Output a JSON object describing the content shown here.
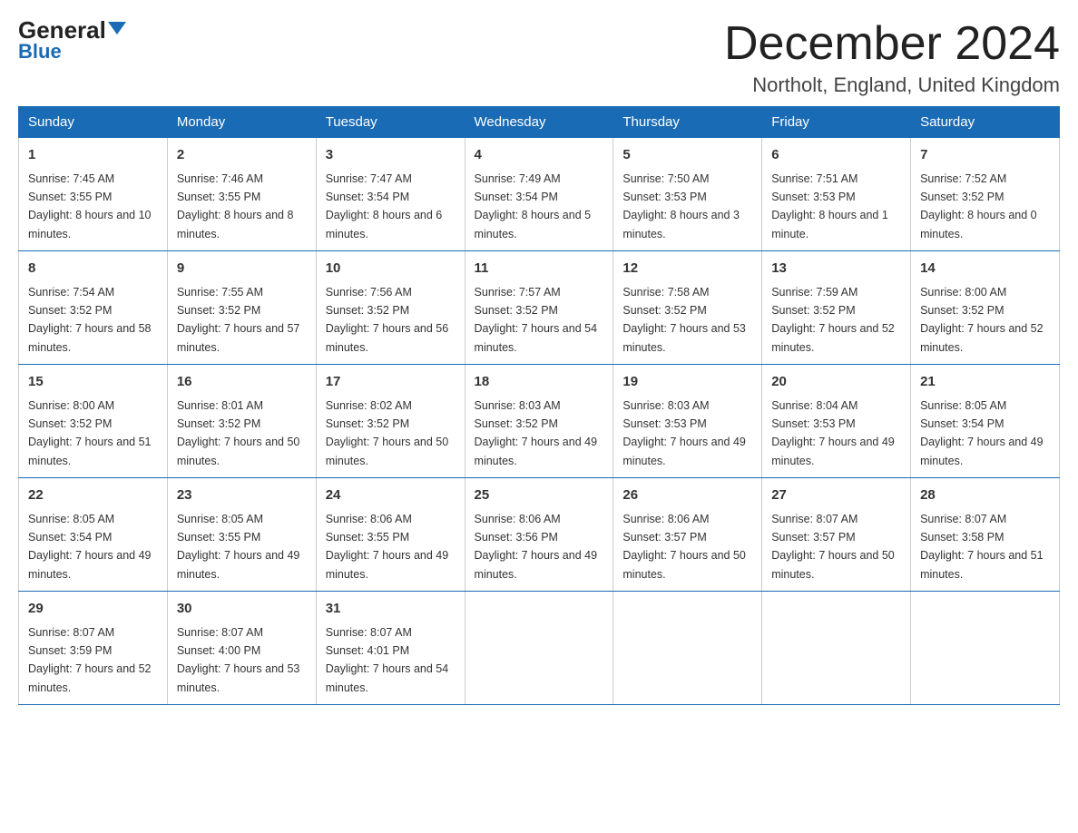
{
  "header": {
    "logo_general": "General",
    "logo_blue": "Blue",
    "title": "December 2024",
    "location": "Northolt, England, United Kingdom"
  },
  "columns": [
    "Sunday",
    "Monday",
    "Tuesday",
    "Wednesday",
    "Thursday",
    "Friday",
    "Saturday"
  ],
  "weeks": [
    [
      {
        "day": "1",
        "sunrise": "7:45 AM",
        "sunset": "3:55 PM",
        "daylight": "8 hours and 10 minutes."
      },
      {
        "day": "2",
        "sunrise": "7:46 AM",
        "sunset": "3:55 PM",
        "daylight": "8 hours and 8 minutes."
      },
      {
        "day": "3",
        "sunrise": "7:47 AM",
        "sunset": "3:54 PM",
        "daylight": "8 hours and 6 minutes."
      },
      {
        "day": "4",
        "sunrise": "7:49 AM",
        "sunset": "3:54 PM",
        "daylight": "8 hours and 5 minutes."
      },
      {
        "day": "5",
        "sunrise": "7:50 AM",
        "sunset": "3:53 PM",
        "daylight": "8 hours and 3 minutes."
      },
      {
        "day": "6",
        "sunrise": "7:51 AM",
        "sunset": "3:53 PM",
        "daylight": "8 hours and 1 minute."
      },
      {
        "day": "7",
        "sunrise": "7:52 AM",
        "sunset": "3:52 PM",
        "daylight": "8 hours and 0 minutes."
      }
    ],
    [
      {
        "day": "8",
        "sunrise": "7:54 AM",
        "sunset": "3:52 PM",
        "daylight": "7 hours and 58 minutes."
      },
      {
        "day": "9",
        "sunrise": "7:55 AM",
        "sunset": "3:52 PM",
        "daylight": "7 hours and 57 minutes."
      },
      {
        "day": "10",
        "sunrise": "7:56 AM",
        "sunset": "3:52 PM",
        "daylight": "7 hours and 56 minutes."
      },
      {
        "day": "11",
        "sunrise": "7:57 AM",
        "sunset": "3:52 PM",
        "daylight": "7 hours and 54 minutes."
      },
      {
        "day": "12",
        "sunrise": "7:58 AM",
        "sunset": "3:52 PM",
        "daylight": "7 hours and 53 minutes."
      },
      {
        "day": "13",
        "sunrise": "7:59 AM",
        "sunset": "3:52 PM",
        "daylight": "7 hours and 52 minutes."
      },
      {
        "day": "14",
        "sunrise": "8:00 AM",
        "sunset": "3:52 PM",
        "daylight": "7 hours and 52 minutes."
      }
    ],
    [
      {
        "day": "15",
        "sunrise": "8:00 AM",
        "sunset": "3:52 PM",
        "daylight": "7 hours and 51 minutes."
      },
      {
        "day": "16",
        "sunrise": "8:01 AM",
        "sunset": "3:52 PM",
        "daylight": "7 hours and 50 minutes."
      },
      {
        "day": "17",
        "sunrise": "8:02 AM",
        "sunset": "3:52 PM",
        "daylight": "7 hours and 50 minutes."
      },
      {
        "day": "18",
        "sunrise": "8:03 AM",
        "sunset": "3:52 PM",
        "daylight": "7 hours and 49 minutes."
      },
      {
        "day": "19",
        "sunrise": "8:03 AM",
        "sunset": "3:53 PM",
        "daylight": "7 hours and 49 minutes."
      },
      {
        "day": "20",
        "sunrise": "8:04 AM",
        "sunset": "3:53 PM",
        "daylight": "7 hours and 49 minutes."
      },
      {
        "day": "21",
        "sunrise": "8:05 AM",
        "sunset": "3:54 PM",
        "daylight": "7 hours and 49 minutes."
      }
    ],
    [
      {
        "day": "22",
        "sunrise": "8:05 AM",
        "sunset": "3:54 PM",
        "daylight": "7 hours and 49 minutes."
      },
      {
        "day": "23",
        "sunrise": "8:05 AM",
        "sunset": "3:55 PM",
        "daylight": "7 hours and 49 minutes."
      },
      {
        "day": "24",
        "sunrise": "8:06 AM",
        "sunset": "3:55 PM",
        "daylight": "7 hours and 49 minutes."
      },
      {
        "day": "25",
        "sunrise": "8:06 AM",
        "sunset": "3:56 PM",
        "daylight": "7 hours and 49 minutes."
      },
      {
        "day": "26",
        "sunrise": "8:06 AM",
        "sunset": "3:57 PM",
        "daylight": "7 hours and 50 minutes."
      },
      {
        "day": "27",
        "sunrise": "8:07 AM",
        "sunset": "3:57 PM",
        "daylight": "7 hours and 50 minutes."
      },
      {
        "day": "28",
        "sunrise": "8:07 AM",
        "sunset": "3:58 PM",
        "daylight": "7 hours and 51 minutes."
      }
    ],
    [
      {
        "day": "29",
        "sunrise": "8:07 AM",
        "sunset": "3:59 PM",
        "daylight": "7 hours and 52 minutes."
      },
      {
        "day": "30",
        "sunrise": "8:07 AM",
        "sunset": "4:00 PM",
        "daylight": "7 hours and 53 minutes."
      },
      {
        "day": "31",
        "sunrise": "8:07 AM",
        "sunset": "4:01 PM",
        "daylight": "7 hours and 54 minutes."
      },
      null,
      null,
      null,
      null
    ]
  ]
}
